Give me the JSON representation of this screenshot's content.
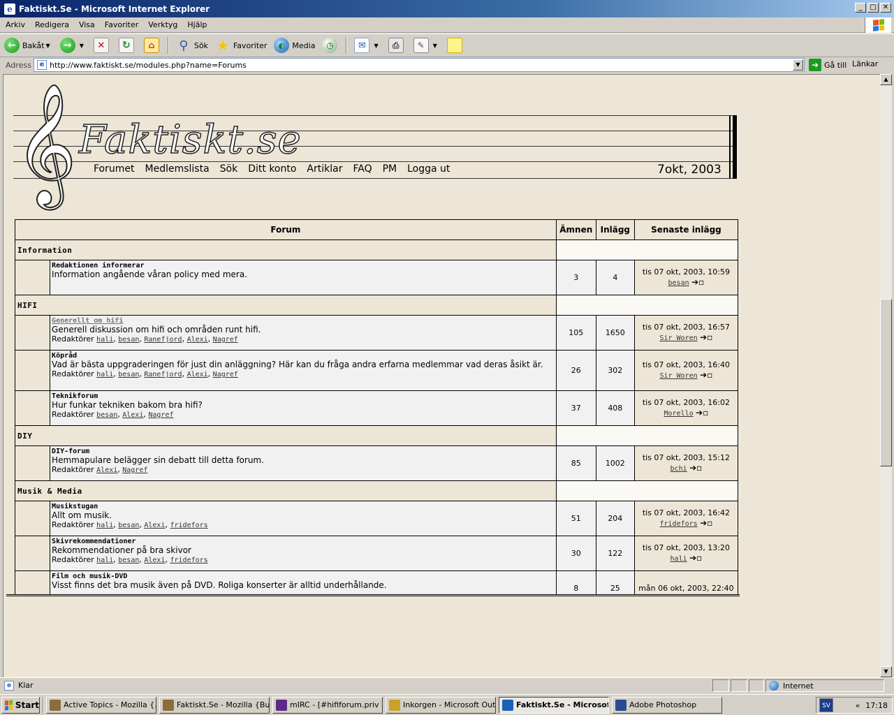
{
  "window": {
    "title": "Faktiskt.Se - Microsoft Internet Explorer",
    "min": "_",
    "max": "□",
    "close": "✕"
  },
  "menu": [
    "Arkiv",
    "Redigera",
    "Visa",
    "Favoriter",
    "Verktyg",
    "Hjälp"
  ],
  "toolbar": {
    "back": "Bakåt",
    "search": "Sök",
    "favorites": "Favoriter",
    "media": "Media"
  },
  "address": {
    "label": "Adress",
    "url": "http://www.faktiskt.se/modules.php?name=Forums",
    "go": "Gå till",
    "links": "Länkar"
  },
  "site": {
    "logo": "Faktiskt.se",
    "nav": [
      "Forumet",
      "Medlemslista",
      "Sök",
      "Ditt konto",
      "Artiklar",
      "FAQ",
      "PM",
      "Logga ut"
    ],
    "date": "7okt, 2003"
  },
  "table": {
    "headers": {
      "forum": "Forum",
      "topics": "Ämnen",
      "posts": "Inlägg",
      "last": "Senaste inlägg"
    },
    "moderators_label": "Redaktörer",
    "categories": [
      {
        "name": "Information",
        "forums": [
          {
            "name": "Redaktionen informerar",
            "visited": false,
            "desc": "Information angående våran policy med mera.",
            "mods": [],
            "topics": "3",
            "posts": "4",
            "last_date": "tis 07 okt, 2003, 10:59",
            "last_user": "besan"
          }
        ]
      },
      {
        "name": "HIFI",
        "forums": [
          {
            "name": "Generellt om hifi",
            "visited": true,
            "desc": "Generell diskussion om hifi och områden runt hifi.",
            "mods": [
              "hali",
              "besan",
              "Ranefjord",
              "Alexi",
              "Nagref"
            ],
            "topics": "105",
            "posts": "1650",
            "last_date": "tis 07 okt, 2003, 16:57",
            "last_user": "Sir Woren"
          },
          {
            "name": "Köpråd",
            "visited": false,
            "desc": "Vad är bästa uppgraderingen för just din anläggning? Här kan du fråga andra erfarna medlemmar vad deras åsikt är.",
            "mods": [
              "hali",
              "besan",
              "Ranefjord",
              "Alexi",
              "Nagref"
            ],
            "topics": "26",
            "posts": "302",
            "last_date": "tis 07 okt, 2003, 16:40",
            "last_user": "Sir Woren"
          },
          {
            "name": "Teknikforum",
            "visited": false,
            "desc": "Hur funkar tekniken bakom bra hifi?",
            "mods": [
              "besan",
              "Alexi",
              "Nagref"
            ],
            "topics": "37",
            "posts": "408",
            "last_date": "tis 07 okt, 2003, 16:02",
            "last_user": "Morello"
          }
        ]
      },
      {
        "name": "DIY",
        "forums": [
          {
            "name": "DIY-forum",
            "visited": false,
            "desc": "Hemmapulare belägger sin debatt till detta forum.",
            "mods": [
              "Alexi",
              "Nagref"
            ],
            "topics": "85",
            "posts": "1002",
            "last_date": "tis 07 okt, 2003, 15:12",
            "last_user": "bchi"
          }
        ]
      },
      {
        "name": "Musik & Media",
        "forums": [
          {
            "name": "Musikstugan",
            "visited": false,
            "desc": "Allt om musik.",
            "mods": [
              "hali",
              "besan",
              "Alexi",
              "fridefors"
            ],
            "topics": "51",
            "posts": "204",
            "last_date": "tis 07 okt, 2003, 16:42",
            "last_user": "fridefors"
          },
          {
            "name": "Skivrekommendationer",
            "visited": false,
            "desc": "Rekommendationer på bra skivor",
            "mods": [
              "hali",
              "besan",
              "Alexi",
              "fridefors"
            ],
            "topics": "30",
            "posts": "122",
            "last_date": "tis 07 okt, 2003, 13:20",
            "last_user": "hali"
          },
          {
            "name": "Film och musik-DVD",
            "visited": false,
            "desc": "Visst finns det bra musik även på DVD. Roliga konserter är alltid underhållande.",
            "mods": [],
            "topics": "8",
            "posts": "25",
            "last_date": "mån 06 okt, 2003, 22:40",
            "last_user": ""
          }
        ]
      }
    ]
  },
  "status": {
    "text": "Klar",
    "zone": "Internet"
  },
  "taskbar": {
    "start": "Start",
    "tasks": [
      {
        "label": "Active Topics - Mozilla {...",
        "active": false,
        "color": "#8a6d3b"
      },
      {
        "label": "Faktiskt.Se - Mozilla {Buil...",
        "active": false,
        "color": "#8a6d3b"
      },
      {
        "label": "mIRC - [#hififorum.priv [...",
        "active": false,
        "color": "#5b2a86"
      },
      {
        "label": "Inkorgen - Microsoft Outl...",
        "active": false,
        "color": "#c9a227"
      },
      {
        "label": "Faktiskt.Se - Microsof...",
        "active": true,
        "color": "#1c5fb8"
      },
      {
        "label": "Adobe Photoshop",
        "active": false,
        "color": "#2a4d8f"
      }
    ],
    "lang": "SV",
    "chevron": "«",
    "clock": "17:18"
  }
}
